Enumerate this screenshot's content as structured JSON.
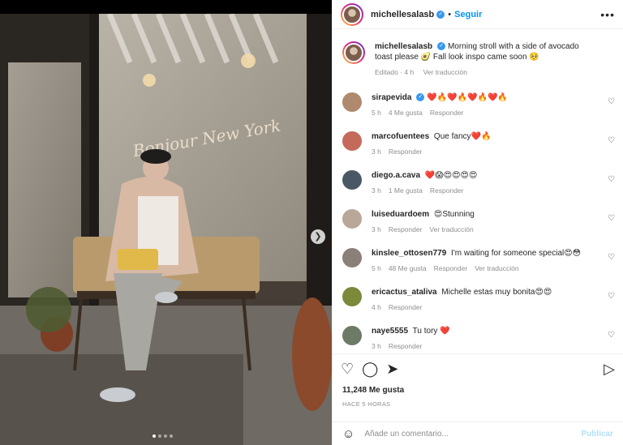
{
  "post": {
    "username": "michellesalasb",
    "follow_label": "Seguir",
    "caption": "Morning stroll with a side of avocado toast please 🥑 Fall look inspo came soon 🥺",
    "caption_meta": {
      "edited": "Editado · 4 h",
      "translate": "Ver traducción"
    },
    "likes": "11,248 Me gusta",
    "time_ago": "HACE 5 HORAS",
    "add_comment_placeholder": "Añade un comentario...",
    "publish_label": "Publicar",
    "photo_text": "Bonjour New York",
    "carousel": {
      "current": 1,
      "total": 4
    }
  },
  "comments": [
    {
      "user": "sirapevida",
      "text": "❤️🔥❤️🔥❤️🔥❤️🔥",
      "time": "5 h",
      "likes": "4 Me gusta",
      "reply": "Responder",
      "translate": "",
      "verified": true,
      "avatar_color": "#b08a6e"
    },
    {
      "user": "marcofuentees",
      "text": "Que fancy❤️🔥",
      "time": "3 h",
      "likes": "",
      "reply": "Responder",
      "translate": "",
      "verified": false,
      "avatar_color": "#c46a5a"
    },
    {
      "user": "diego.a.cava",
      "text": "❤️😱😍😍😍😍",
      "time": "3 h",
      "likes": "1 Me gusta",
      "reply": "Responder",
      "translate": "",
      "verified": false,
      "avatar_color": "#4a5866"
    },
    {
      "user": "luiseduardoem",
      "text": "😍Stunning",
      "time": "3 h",
      "likes": "",
      "reply": "Responder",
      "translate": "Ver traducción",
      "verified": false,
      "avatar_color": "#b9a79a"
    },
    {
      "user": "kinslee_ottosen779",
      "text": "I'm waiting for someone special😍😳",
      "time": "5 h",
      "likes": "48 Me gusta",
      "reply": "Responder",
      "translate": "Ver traducción",
      "verified": false,
      "avatar_color": "#8a7f79"
    },
    {
      "user": "ericactus_ataliva",
      "text": "Michelle estas muy bonita😍😍",
      "time": "4 h",
      "likes": "",
      "reply": "Responder",
      "translate": "",
      "verified": false,
      "avatar_color": "#7a8a3a"
    },
    {
      "user": "naye5555",
      "text": "Tu tory ❤️",
      "time": "3 h",
      "likes": "",
      "reply": "Responder",
      "translate": "",
      "verified": false,
      "avatar_color": "#6d7a66"
    }
  ],
  "icons": {
    "more": "more-options-icon",
    "like": "heart-icon",
    "comment": "comment-icon",
    "share": "share-icon",
    "save": "bookmark-icon",
    "emoji": "emoji-icon",
    "next": "chevron-right-icon"
  }
}
